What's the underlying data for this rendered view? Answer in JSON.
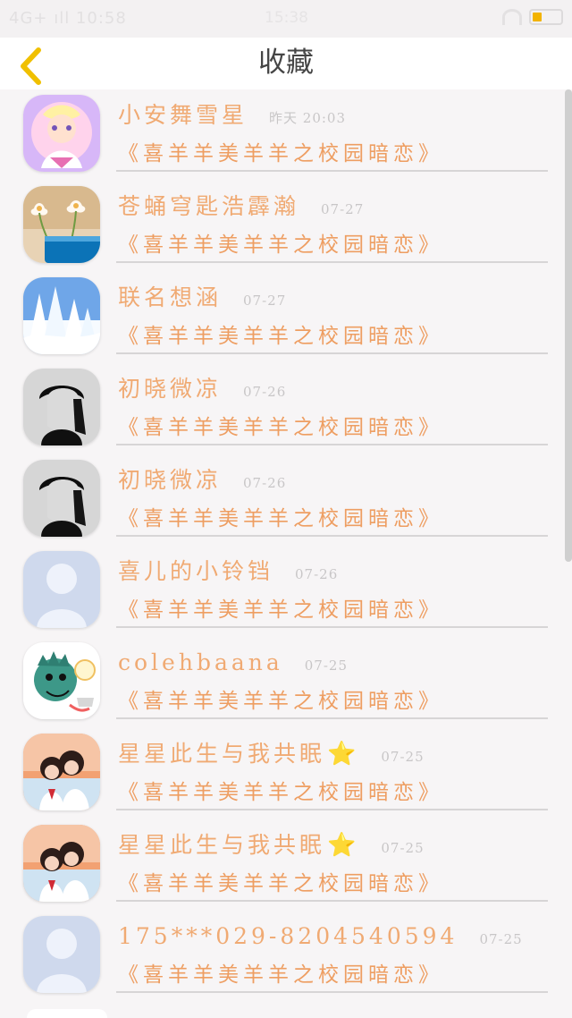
{
  "status_bar": {
    "left": "4G+ ıll 10:58",
    "center": "15:38"
  },
  "header": {
    "title": "收藏"
  },
  "favorites": [
    {
      "name": "小安舞雪星",
      "date": "昨天 20:03",
      "book": "《喜羊羊美羊羊之校园暗恋》",
      "avatar_icon": "anime-avatar-icon"
    },
    {
      "name": "苍蛹穹匙浩霹瀚",
      "date": "07-27",
      "book": "《喜羊羊美羊羊之校园暗恋》",
      "avatar_icon": "flower-avatar-icon"
    },
    {
      "name": "联名想涵",
      "date": "07-27",
      "book": "《喜羊羊美羊羊之校园暗恋》",
      "avatar_icon": "snow-trees-avatar-icon"
    },
    {
      "name": "初晓微凉",
      "date": "07-26",
      "book": "《喜羊羊美羊羊之校园暗恋》",
      "avatar_icon": "person-cap-avatar-icon"
    },
    {
      "name": "初晓微凉",
      "date": "07-26",
      "book": "《喜羊羊美羊羊之校园暗恋》",
      "avatar_icon": "person-cap-avatar-icon"
    },
    {
      "name": "喜儿的小铃铛",
      "date": "07-26",
      "book": "《喜羊羊美羊羊之校园暗恋》",
      "avatar_icon": "default-user-avatar-icon"
    },
    {
      "name": "colehbaana",
      "date": "07-25",
      "book": "《喜羊羊美羊羊之校园暗恋》",
      "avatar_icon": "dinosaur-avatar-icon"
    },
    {
      "name": "星星此生与我共眠",
      "name_suffix": "⭐",
      "date": "07-25",
      "book": "《喜羊羊美羊羊之校园暗恋》",
      "avatar_icon": "couple-sunset-avatar-icon"
    },
    {
      "name": "星星此生与我共眠",
      "name_suffix": "⭐",
      "date": "07-25",
      "book": "《喜羊羊美羊羊之校园暗恋》",
      "avatar_icon": "couple-sunset-avatar-icon"
    },
    {
      "name": "175***029-8204540594",
      "date": "07-25",
      "book": "《喜羊羊美羊羊之校园暗恋》",
      "avatar_icon": "default-user-avatar-icon"
    }
  ],
  "colors": {
    "accent": "#f0aa73",
    "back_arrow": "#f0c000",
    "divider": "#d7d5d6"
  }
}
